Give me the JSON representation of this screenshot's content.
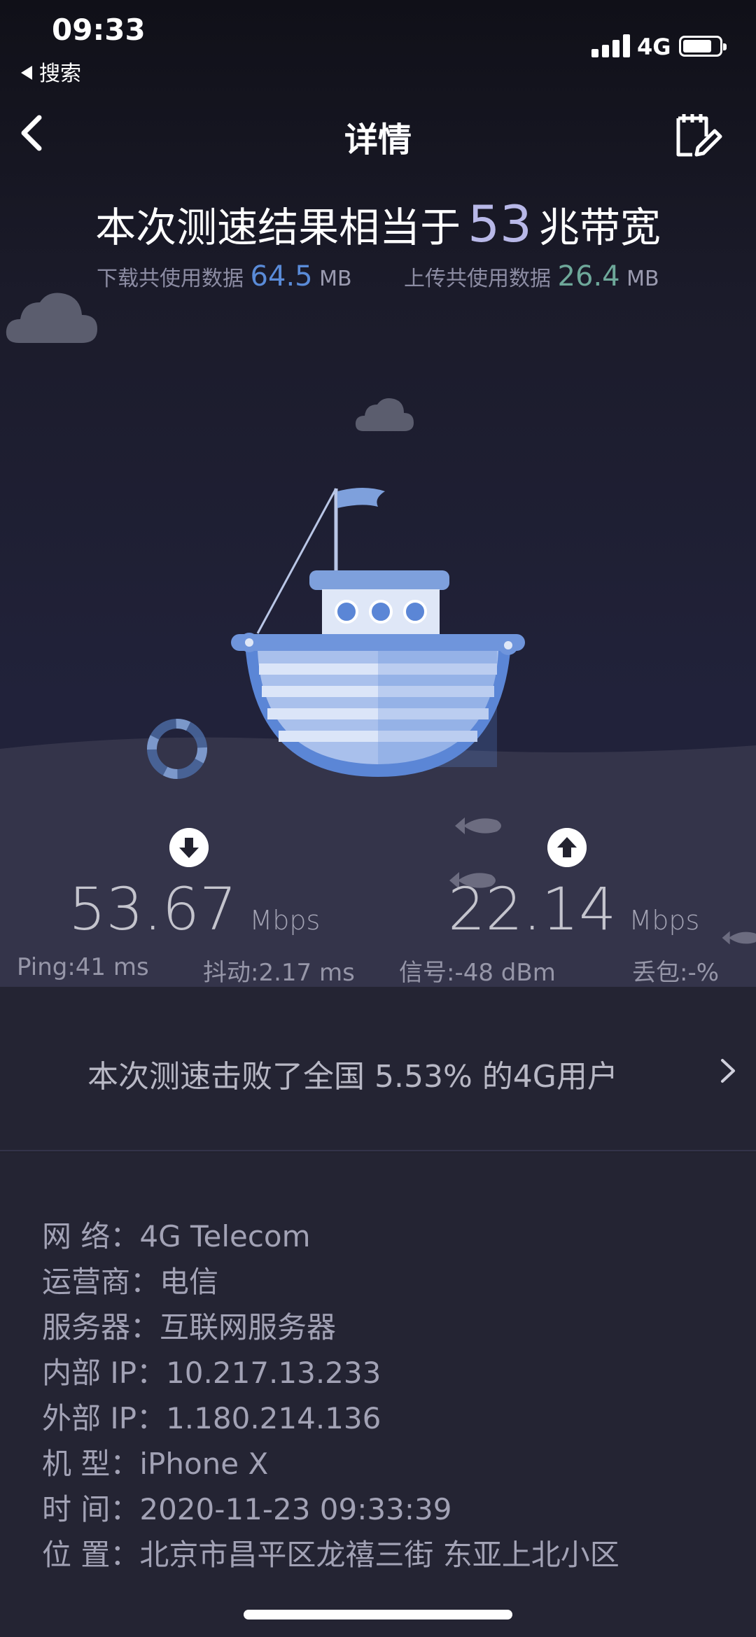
{
  "status_bar": {
    "time": "09:33",
    "back_app": "搜索",
    "network": "4G"
  },
  "nav": {
    "title": "详情"
  },
  "summary": {
    "prefix": "本次测速结果相当于",
    "bandwidth": "53",
    "suffix": "兆带宽",
    "download_label": "下载共使用数据",
    "download_value": "64.5",
    "download_unit": "MB",
    "upload_label": "上传共使用数据",
    "upload_value": "26.4",
    "upload_unit": "MB"
  },
  "speeds": {
    "download": "53.67",
    "download_unit": "Mbps",
    "upload": "22.14",
    "upload_unit": "Mbps"
  },
  "metrics": {
    "ping": "Ping:41 ms",
    "jitter": "抖动:2.17 ms",
    "signal": "信号:-48 dBm",
    "loss": "丢包:-%"
  },
  "result": {
    "text": "本次测速击败了全国 5.53% 的4G用户"
  },
  "info": [
    {
      "label": "网 络：",
      "value": "4G Telecom"
    },
    {
      "label": "运营商：",
      "value": "电信"
    },
    {
      "label": "服务器：",
      "value": "互联网服务器"
    },
    {
      "label": "内部 IP：",
      "value": "10.217.13.233"
    },
    {
      "label": "外部 IP：",
      "value": "1.180.214.136"
    },
    {
      "label": "机 型：",
      "value": "iPhone X"
    },
    {
      "label": "时 间：",
      "value": "2020-11-23 09:33:39"
    },
    {
      "label": "位 置：",
      "value": "北京市昌平区龙禧三街 东亚上北小区"
    }
  ],
  "colors": {
    "download_accent": "#5a8bd8",
    "upload_accent": "#6ea89a",
    "boat_blue": "#5b86d6"
  }
}
